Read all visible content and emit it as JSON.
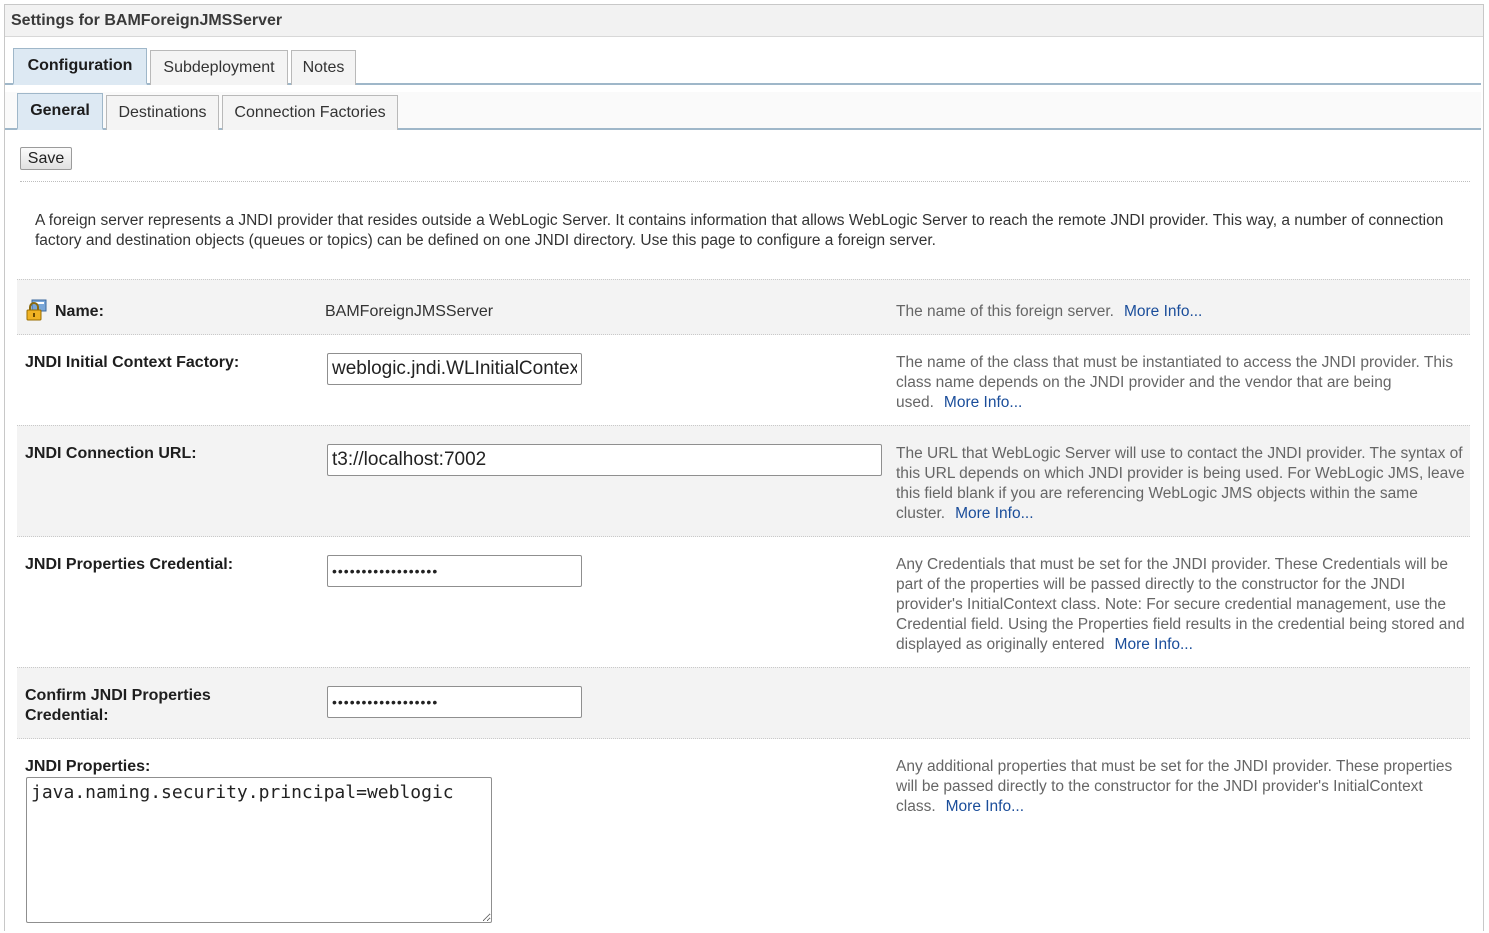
{
  "page": {
    "title": "Settings for BAMForeignJMSServer"
  },
  "tabs_primary": [
    {
      "label": "Configuration",
      "active": true
    },
    {
      "label": "Subdeployment",
      "active": false
    },
    {
      "label": "Notes",
      "active": false
    }
  ],
  "tabs_secondary": [
    {
      "label": "General",
      "active": true
    },
    {
      "label": "Destinations",
      "active": false
    },
    {
      "label": "Connection Factories",
      "active": false
    }
  ],
  "toolbar": {
    "save_label": "Save"
  },
  "intro": "A foreign server represents a JNDI provider that resides outside a WebLogic Server. It contains information that allows WebLogic Server to reach the remote JNDI provider. This way, a number of connection factory and destination objects (queues or topics) can be defined on one JNDI directory. Use this page to configure a foreign server.",
  "more_info_label": "More Info...",
  "fields": {
    "name": {
      "label": "Name:",
      "value": "BAMForeignJMSServer",
      "help": "The name of this foreign server."
    },
    "initial_context_factory": {
      "label": "JNDI Initial Context Factory:",
      "value": "weblogic.jndi.WLInitialContextFactory",
      "help": "The name of the class that must be instantiated to access the JNDI provider. This class name depends on the JNDI provider and the vendor that are being used."
    },
    "connection_url": {
      "label": "JNDI Connection URL:",
      "value": "t3://localhost:7002",
      "help": "The URL that WebLogic Server will use to contact the JNDI provider. The syntax of this URL depends on which JNDI provider is being used. For WebLogic JMS, leave this field blank if you are referencing WebLogic JMS objects within the same cluster."
    },
    "properties_credential": {
      "label": "JNDI Properties Credential:",
      "value": "••••••••••••••••••",
      "help": "Any Credentials that must be set for the JNDI provider. These Credentials will be part of the properties will be passed directly to the constructor for the JNDI provider's InitialContext class. Note: For secure credential management, use the Credential field. Using the Properties field results in the credential being stored and displayed as originally entered"
    },
    "confirm_credential": {
      "label": "Confirm JNDI Properties Credential:",
      "value": "••••••••••••••••••"
    },
    "properties": {
      "label": "JNDI Properties:",
      "value": "java.naming.security.principal=weblogic",
      "help": "Any additional properties that must be set for the JNDI provider. These properties will be passed directly to the constructor for the JNDI provider's InitialContext class."
    }
  },
  "icons": {
    "name_icon": "config-lock-icon"
  },
  "colors": {
    "link": "#1a4d9a",
    "tab_active_bg": "#dde9f3",
    "tab_border": "#9fb7c9",
    "row_shade": "#f3f3f3"
  }
}
